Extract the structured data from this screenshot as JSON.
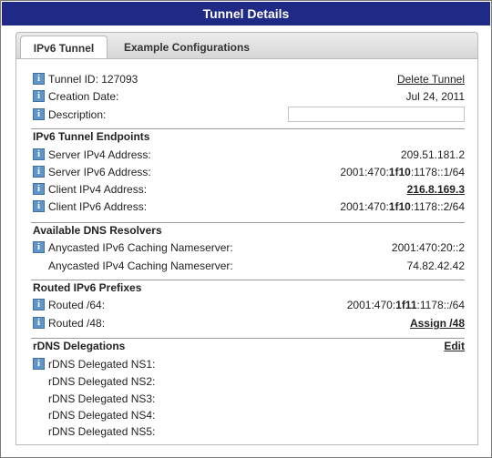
{
  "window": {
    "title": "Tunnel Details"
  },
  "tabs": {
    "active": "IPv6 Tunnel",
    "inactive": "Example Configurations"
  },
  "tunnel": {
    "id_label": "Tunnel ID: 127093",
    "delete_label": "Delete Tunnel",
    "created_label": "Creation Date:",
    "created_value": "Jul 24, 2011",
    "description_label": "Description:",
    "description_value": ""
  },
  "endpoints": {
    "heading": "IPv6 Tunnel Endpoints",
    "server_v4_label": "Server IPv4 Address:",
    "server_v4_value": "209.51.181.2",
    "server_v6_label": "Server IPv6 Address:",
    "server_v6_pre": "2001:470:",
    "server_v6_bold": "1f10",
    "server_v6_post": ":1178::1/64",
    "client_v4_label": "Client IPv4 Address:",
    "client_v4_value": "216.8.169.3",
    "client_v6_label": "Client IPv6 Address:",
    "client_v6_pre": "2001:470:",
    "client_v6_bold": "1f10",
    "client_v6_post": ":1178::2/64"
  },
  "dns": {
    "heading": "Available DNS Resolvers",
    "v6_label": "Anycasted IPv6 Caching Nameserver:",
    "v6_value": "2001:470:20::2",
    "v4_label": "Anycasted IPv4 Caching Nameserver:",
    "v4_value": "74.82.42.42"
  },
  "prefixes": {
    "heading": "Routed IPv6 Prefixes",
    "r64_label": "Routed /64:",
    "r64_pre": "2001:470:",
    "r64_bold": "1f11",
    "r64_post": ":1178::/64",
    "r48_label": "Routed /48:",
    "r48_link": "Assign /48"
  },
  "rdns": {
    "heading": "rDNS Delegations",
    "edit_label": "Edit",
    "ns1": "rDNS Delegated NS1:",
    "ns2": "rDNS Delegated NS2:",
    "ns3": "rDNS Delegated NS3:",
    "ns4": "rDNS Delegated NS4:",
    "ns5": "rDNS Delegated NS5:"
  },
  "icons": {
    "info": "info-icon",
    "info_glyph": "i"
  },
  "colors": {
    "titlebar": "#1f2a86",
    "info_icon": "#5f95c8"
  }
}
